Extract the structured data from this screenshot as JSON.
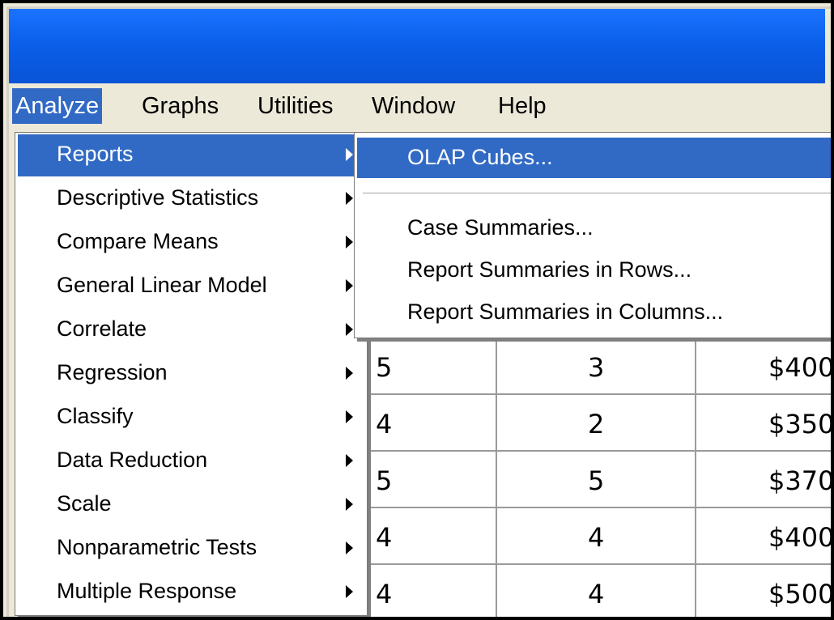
{
  "menubar": {
    "items": [
      "Analyze",
      "Graphs",
      "Utilities",
      "Window",
      "Help"
    ]
  },
  "analyze_menu": {
    "items": [
      "Reports",
      "Descriptive Statistics",
      "Compare Means",
      "General Linear Model",
      "Correlate",
      "Regression",
      "Classify",
      "Data Reduction",
      "Scale",
      "Nonparametric Tests",
      "Multiple Response"
    ]
  },
  "reports_submenu": {
    "items": [
      "OLAP Cubes...",
      "Case Summaries...",
      "Report Summaries in Rows...",
      "Report Summaries in Columns..."
    ]
  },
  "data_grid": {
    "rows": [
      [
        "5",
        "3",
        "$400"
      ],
      [
        "4",
        "2",
        "$350"
      ],
      [
        "5",
        "5",
        "$370"
      ],
      [
        "4",
        "4",
        "$400"
      ],
      [
        "4",
        "4",
        "$500"
      ]
    ]
  },
  "colors": {
    "title_bar": "#0a5ee8",
    "highlight": "#316ac5",
    "menu_bg": "#ece9d8"
  }
}
